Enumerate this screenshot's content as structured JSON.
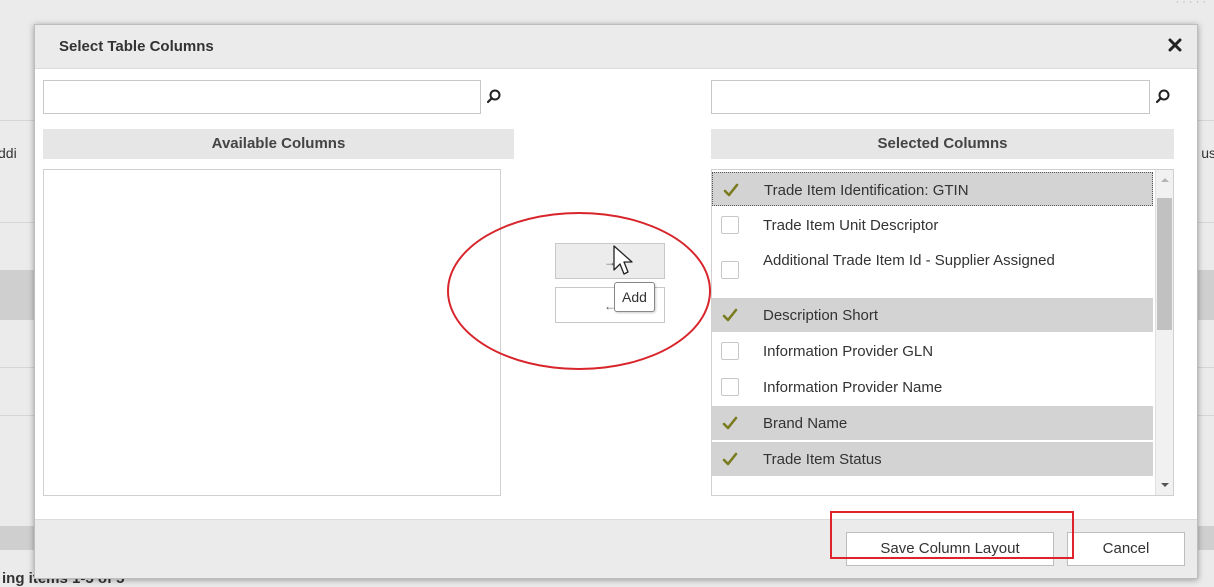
{
  "background": {
    "left_fragment": "ddi",
    "right_fragment": "us",
    "footer_text": "ing items 1-5 of 5"
  },
  "dialog": {
    "title": "Select Table Columns"
  },
  "available": {
    "search_value": "",
    "header": "Available Columns",
    "items": []
  },
  "selected": {
    "search_value": "",
    "header": "Selected Columns",
    "items": [
      {
        "label": "Trade Item Identification: GTIN",
        "checked": true
      },
      {
        "label": "Trade Item Unit Descriptor",
        "checked": false
      },
      {
        "label": "Additional Trade Item Id - Supplier Assigned",
        "checked": false
      },
      {
        "label": "Description Short",
        "checked": true
      },
      {
        "label": "Information Provider GLN",
        "checked": false
      },
      {
        "label": "Information Provider Name",
        "checked": false
      },
      {
        "label": "Brand Name",
        "checked": true
      },
      {
        "label": "Trade Item Status",
        "checked": true
      }
    ]
  },
  "move_buttons": {
    "add_label": "→",
    "remove_label": "←",
    "tooltip": "Add"
  },
  "footer": {
    "save_label": "Save Column Layout",
    "cancel_label": "Cancel"
  },
  "colors": {
    "annotation": "#d8252b",
    "check": "#7a7a1e",
    "selected_row": "#d3d3d3"
  }
}
